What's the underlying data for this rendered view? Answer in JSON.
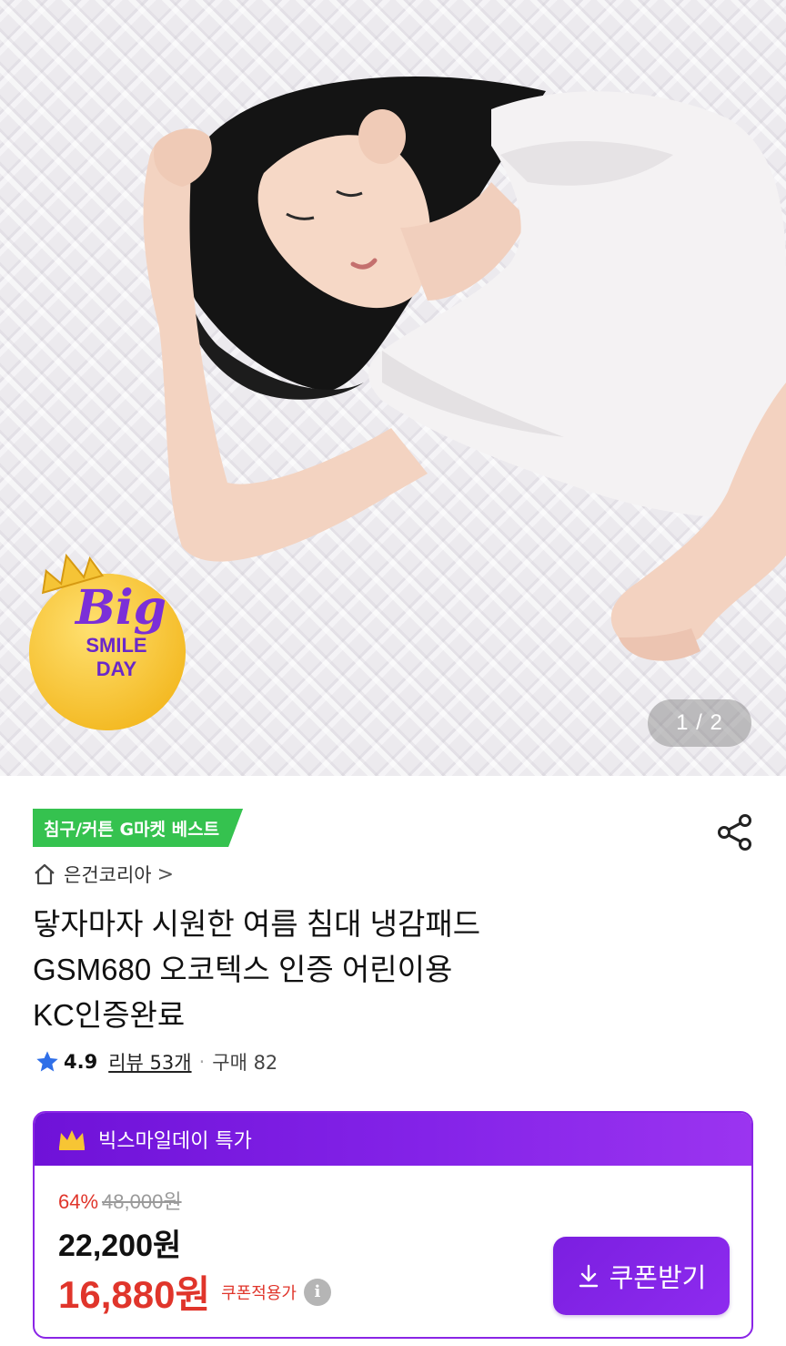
{
  "hero": {
    "counter": "1 / 2",
    "badge": {
      "line1": "Big",
      "line2": "SMILE",
      "line3": "DAY"
    }
  },
  "product": {
    "category_tag": "침구/커튼 G마켓 베스트",
    "store_name": "은건코리아",
    "store_chevron": ">",
    "title_lines": [
      "닿자마자 시원한 여름 침대 냉감패드",
      "GSM680 오코텍스 인증 어린이용",
      "KC인증완료"
    ],
    "rating": "4.9",
    "reviews": "리뷰 53개",
    "separator": "·",
    "purchases": "구매 82"
  },
  "deal": {
    "header": "빅스마일데이 특가",
    "discount_percent": "64%",
    "original_price": "48,000원",
    "price": "22,200원",
    "coupon_price": "16,880원",
    "coupon_note": "쿠폰적용가",
    "info": "i",
    "coupon_button": "쿠폰받기"
  },
  "colors": {
    "accent_purple": "#8423e8",
    "sale_red": "#e0352b",
    "tag_green": "#35c24f",
    "star_blue": "#2f6fe8"
  }
}
